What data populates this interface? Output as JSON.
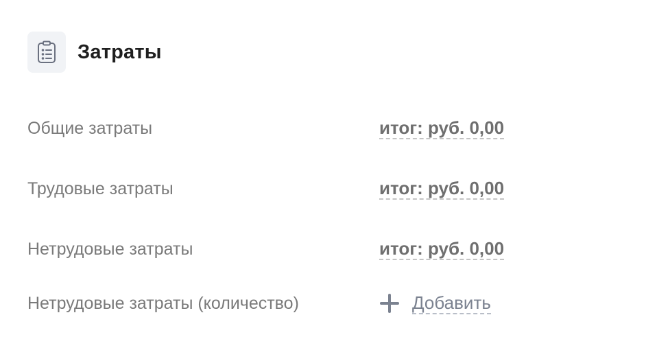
{
  "section": {
    "title": "Затраты",
    "icon": "clipboard-list-icon"
  },
  "rows": [
    {
      "label": "Общие затраты",
      "value": "итог: руб. 0,00"
    },
    {
      "label": "Трудовые затраты",
      "value": "итог: руб. 0,00"
    },
    {
      "label": "Нетрудовые затраты",
      "value": "итог: руб. 0,00"
    }
  ],
  "quantity_row": {
    "label": "Нетрудовые затраты (количество)",
    "add_label": "Добавить",
    "add_icon": "plus-icon"
  },
  "colors": {
    "label": "#7a7a7a",
    "value": "#6f6f6f",
    "action": "#7b8290",
    "icon_bg": "#f1f3f6"
  }
}
